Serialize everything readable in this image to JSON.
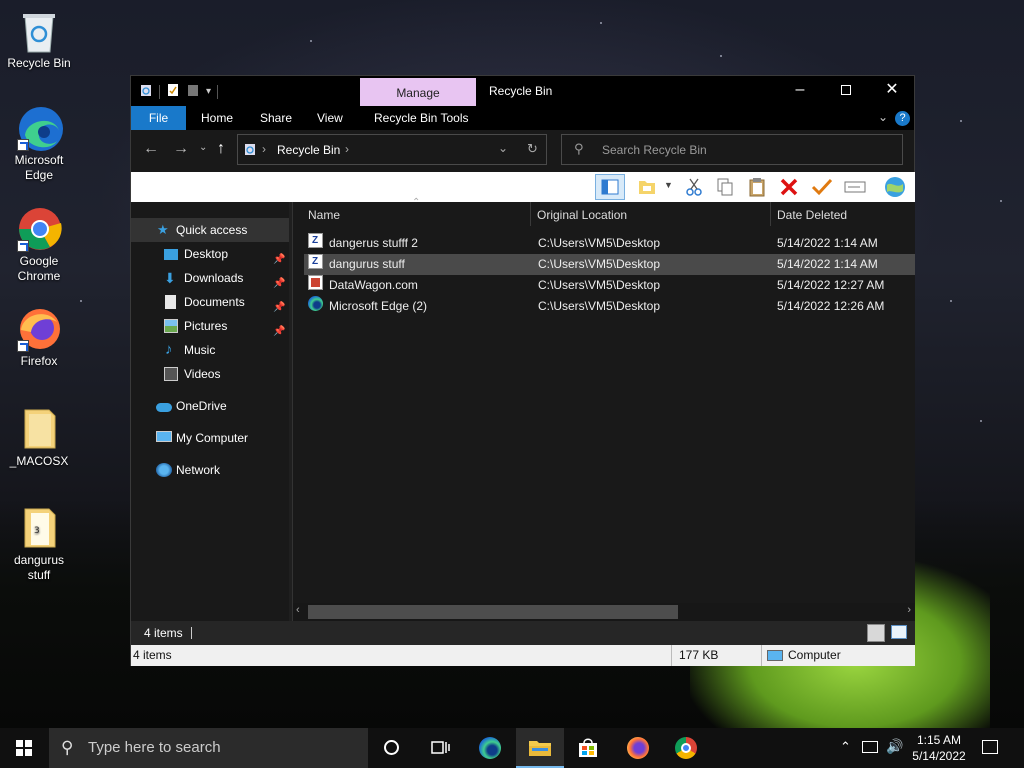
{
  "desktop": {
    "icons": [
      {
        "label": "Recycle Bin",
        "icon": "recycle-bin-icon"
      },
      {
        "label": "Microsoft\nEdge",
        "icon": "edge-icon"
      },
      {
        "label": "Google\nChrome",
        "icon": "chrome-icon"
      },
      {
        "label": "Firefox",
        "icon": "firefox-icon"
      },
      {
        "label": "_MACOSX",
        "icon": "folder-icon"
      },
      {
        "label": "dangurus\nstuff",
        "icon": "zip-folder-icon"
      }
    ]
  },
  "window": {
    "title": "Recycle Bin",
    "manage_tab": "Manage",
    "ribbon_tabs": {
      "file": "File",
      "home": "Home",
      "share": "Share",
      "view": "View",
      "tools": "Recycle Bin Tools"
    },
    "address": {
      "crumb": "Recycle Bin"
    },
    "search": {
      "placeholder": "Search Recycle Bin"
    },
    "nav": {
      "quick_access": "Quick access",
      "desktop": "Desktop",
      "downloads": "Downloads",
      "documents": "Documents",
      "pictures": "Pictures",
      "music": "Music",
      "videos": "Videos",
      "onedrive": "OneDrive",
      "my_computer": "My Computer",
      "network": "Network"
    },
    "columns": {
      "name": "Name",
      "location": "Original Location",
      "date": "Date Deleted"
    },
    "files": [
      {
        "name": "dangerus stufff 2",
        "location": "C:\\Users\\VM5\\Desktop",
        "date": "5/14/2022 1:14 AM",
        "icon": "zip-file-icon"
      },
      {
        "name": "dangurus stuff",
        "location": "C:\\Users\\VM5\\Desktop",
        "date": "5/14/2022 1:14 AM",
        "icon": "zip-file-icon"
      },
      {
        "name": "DataWagon.com",
        "location": "C:\\Users\\VM5\\Desktop",
        "date": "5/14/2022 12:27 AM",
        "icon": "web-shortcut-icon"
      },
      {
        "name": "Microsoft Edge (2)",
        "location": "C:\\Users\\VM5\\Desktop",
        "date": "5/14/2022 12:26 AM",
        "icon": "edge-icon"
      }
    ],
    "status_items": "4 items",
    "status2": {
      "items": "4 items",
      "size": "177 KB",
      "location": "Computer"
    }
  },
  "taskbar": {
    "search_placeholder": "Type here to search",
    "time": "1:15 AM",
    "date": "5/14/2022"
  },
  "colors": {
    "accent": "#1979ca",
    "manage_tab": "#e8c5f2",
    "selection": "#4a4a4a"
  }
}
